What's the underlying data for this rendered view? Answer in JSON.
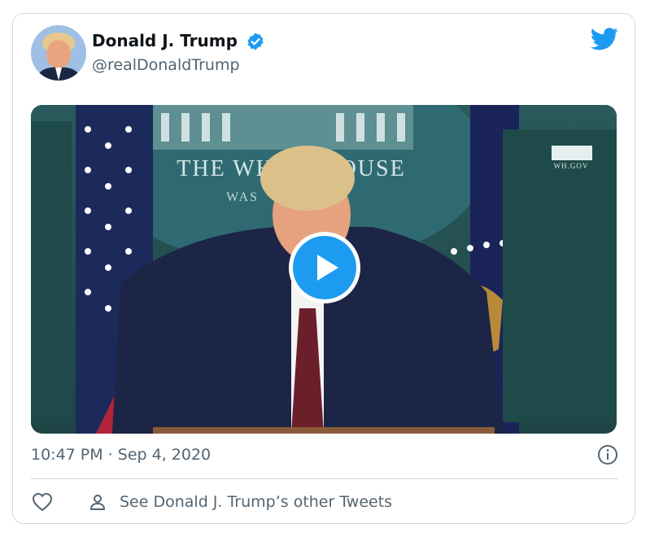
{
  "tweet": {
    "author_name": "Donald J. Trump",
    "author_handle": "@realDonaldTrump",
    "timestamp": "10:47 PM · Sep 4, 2020",
    "other_tweets_label": "See Donald J. Trump’s other Tweets"
  },
  "video": {
    "seal_text_line1": "THE WHITE HOUSE",
    "seal_text_line2": "WAS",
    "watermark": "WH.GOV"
  },
  "icons": {
    "verified": "verified-badge-icon",
    "brand": "twitter-bird-icon",
    "play": "play-icon",
    "info": "info-icon",
    "like": "heart-icon",
    "profile": "person-icon"
  },
  "colors": {
    "accent": "#1d9bf0",
    "text": "#0f1419",
    "secondary_text": "#536471",
    "border": "#cfd9de"
  }
}
